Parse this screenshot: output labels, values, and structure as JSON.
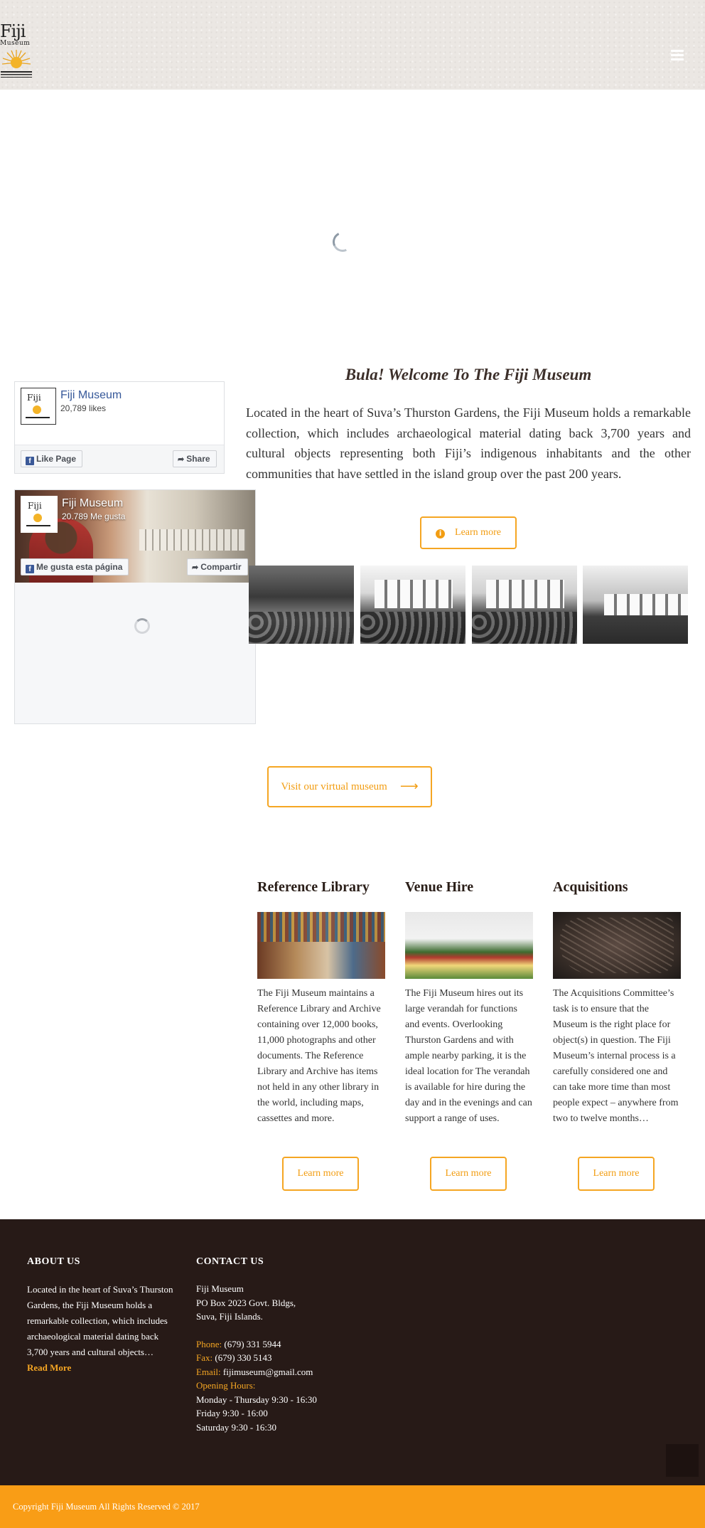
{
  "header": {
    "logo_line1": "Fiji",
    "logo_line2": "Museum",
    "menu_icon": "hamburger-icon"
  },
  "facebook_widget_1": {
    "name": "Fiji Museum",
    "likes": "20,789 likes",
    "like_button": "Like Page",
    "share_button": "Share"
  },
  "facebook_widget_2": {
    "name": "Fiji Museum",
    "likes": "20.789 Me gusta",
    "like_button": "Me gusta esta página",
    "share_button": "Compartir"
  },
  "welcome": {
    "title": "Bula! Welcome To The Fiji Museum",
    "text": "Located in the heart of Suva’s Thurston Gardens, the Fiji Museum holds a remarkable collection, which includes archaeological material dating back 3,700 years and cultural objects representing both Fiji’s indigenous inhabitants and the other communities that have settled in the island group over the past 200 years.",
    "button": "Learn more"
  },
  "virtual_museum": {
    "button": "Visit our virtual museum"
  },
  "services": [
    {
      "title": "Reference Library",
      "text": "The Fiji Museum maintains a Reference Library and Archive containing over 12,000 books, 11,000 photographs and other documents. The Reference Library and Archive has items not held in any other library in the world, including maps, cassettes and more.",
      "button": "Learn more"
    },
    {
      "title": "Venue Hire",
      "text": "The Fiji Museum hires out its large verandah for functions and events. Overlooking Thurston Gardens and with ample nearby parking, it is the ideal location for The verandah is available for hire during the day and in the evenings and can support a range of uses.",
      "button": "Learn more"
    },
    {
      "title": "Acquisitions",
      "text": "The Acquisitions Committee’s task is to ensure that the Museum is the right place for object(s) in question. The Fiji Museum’s internal process is a carefully considered one and can take more time than most people expect – anywhere from two to twelve months…",
      "button": "Learn more"
    }
  ],
  "footer": {
    "about_heading": "ABOUT US",
    "about_text": "Located in the heart of Suva’s Thurston Gardens, the Fiji Museum holds a remarkable collection, which includes archaeological material dating back 3,700 years and cultural objects…",
    "read_more": "Read More",
    "contact_heading": "CONTACT US",
    "address_lines": [
      "Fiji Museum",
      "PO Box 2023 Govt. Bldgs,",
      "Suva, Fiji Islands."
    ],
    "phone_label": "Phone:",
    "phone": "(679) 331 5944",
    "fax_label": "Fax:",
    "fax": "(679) 330 5143",
    "email_label": "Email:",
    "email": "fijimuseum@gmail.com",
    "hours_label": "Opening Hours:",
    "hours": [
      "Monday - Thursday 9:30 - 16:30",
      "Friday 9:30 - 16:00",
      "Saturday 9:30 - 16:30"
    ]
  },
  "copyright": "Copyright Fiji Museum All Rights Reserved © 2017",
  "colors": {
    "accent": "#f5a623",
    "footer_bg": "#271a17",
    "copyright_bg": "#f99d16",
    "facebook_blue": "#3b5998"
  }
}
